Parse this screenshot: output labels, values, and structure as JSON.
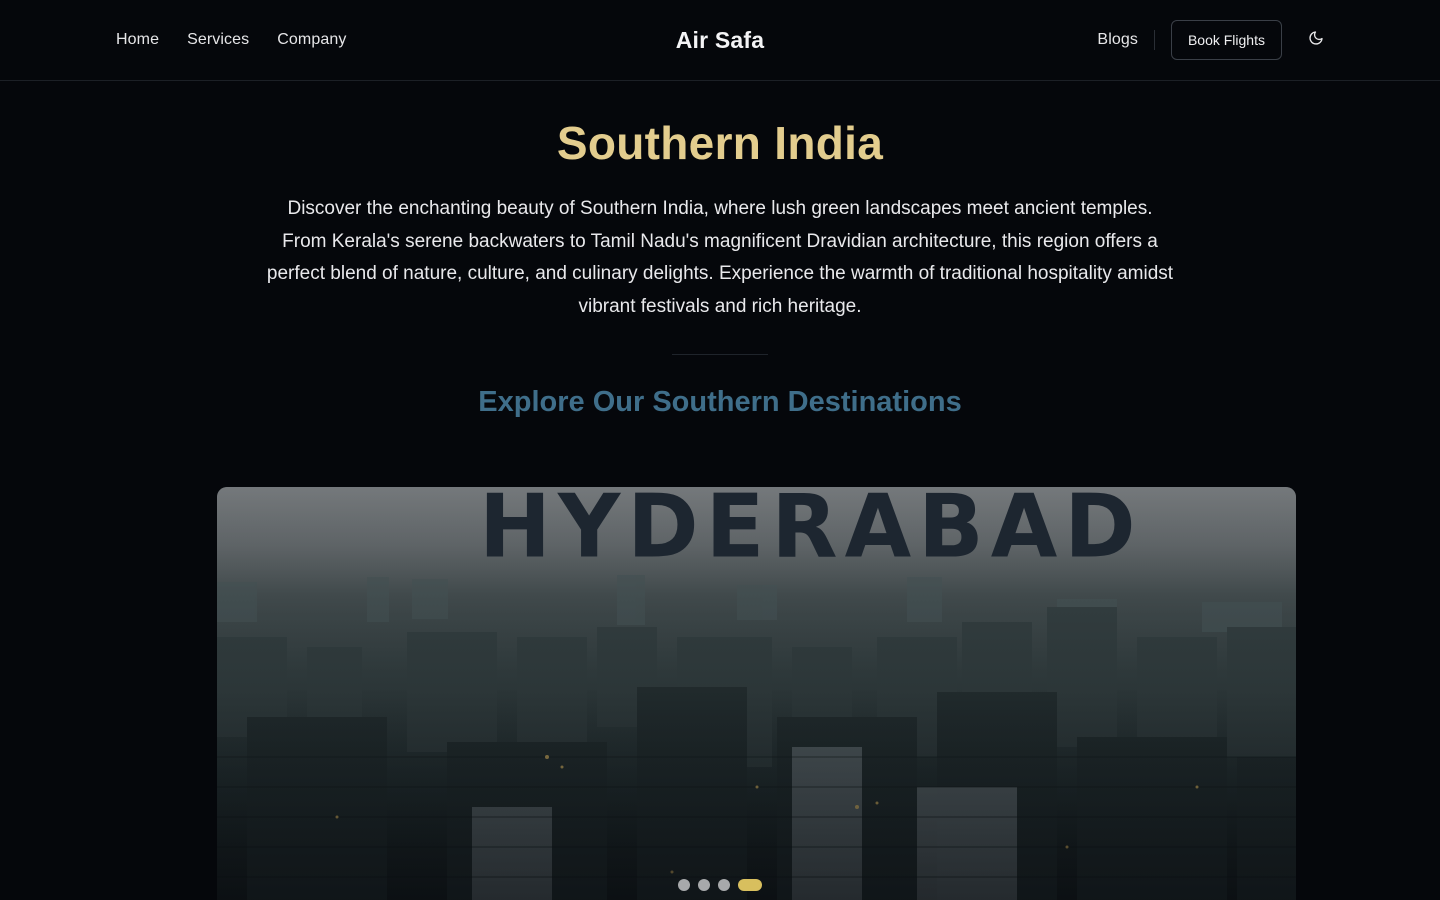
{
  "header": {
    "nav": [
      "Home",
      "Services",
      "Company"
    ],
    "brand": "Air Safa",
    "blogs_label": "Blogs",
    "book_label": "Book Flights",
    "theme_icon": "moon-icon"
  },
  "hero": {
    "title": "Southern India",
    "description": "Discover the enchanting beauty of Southern India, where lush green landscapes meet ancient temples. From Kerala's serene backwaters to Tamil Nadu's magnificent Dravidian architecture, this region offers a perfect blend of nature, culture, and culinary delights. Experience the warmth of traditional hospitality amidst vibrant festivals and rich heritage.",
    "section_heading": "Explore Our Southern Destinations"
  },
  "carousel": {
    "slide_caption": "HYDERABAD",
    "slide_count": 4,
    "active_index": 3
  },
  "colors": {
    "background": "#05070b",
    "title_gold": "#e3cd8e",
    "heading_blue": "#3f6e8a",
    "active_dot": "#d8bf5e"
  }
}
